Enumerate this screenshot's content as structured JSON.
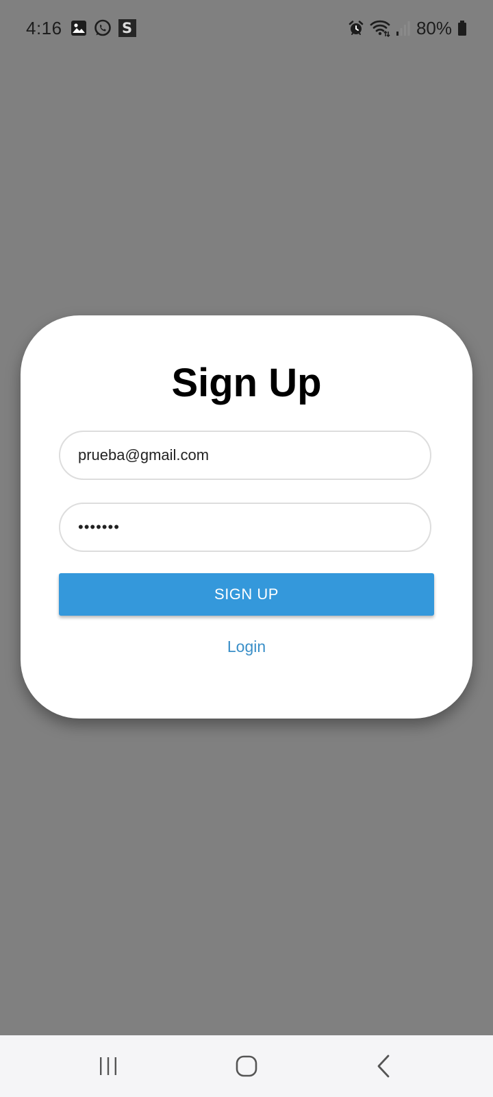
{
  "status_bar": {
    "time": "4:16",
    "battery": "80%",
    "notification_icons": [
      "gallery-icon",
      "whatsapp-icon",
      "s-app-icon"
    ],
    "s_app_label": "S",
    "system_icons": [
      "alarm-icon",
      "wifi-icon",
      "signal-icon",
      "battery-icon"
    ]
  },
  "card": {
    "title": "Sign Up",
    "email_value": "prueba@gmail.com",
    "password_value": "•••••••",
    "signup_label": "SIGN UP",
    "login_label": "Login"
  },
  "nav_bar": {
    "buttons": [
      "recents-icon",
      "home-icon",
      "back-icon"
    ]
  },
  "colors": {
    "background_overlay": "#808080",
    "card": "#ffffff",
    "primary_button": "#3498db",
    "link": "#3a8fc8",
    "nav_bar": "#f5f5f7"
  }
}
